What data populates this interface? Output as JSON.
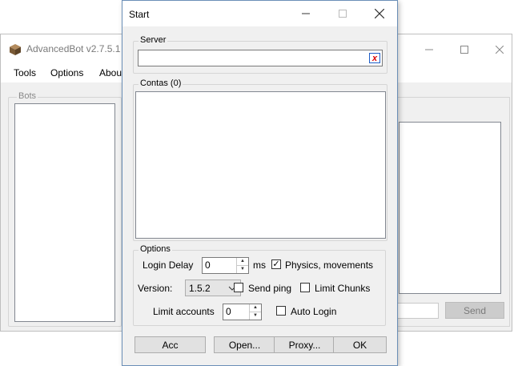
{
  "main_window": {
    "title": "AdvancedBot v2.7.5.1",
    "menu": [
      "Tools",
      "Options",
      "About"
    ],
    "bots_label": "Bots",
    "send_label": "Send"
  },
  "dialog": {
    "title": "Start",
    "server": {
      "label": "Server",
      "value": "",
      "clear_glyph": "x"
    },
    "contas": {
      "label": "Contas (0)"
    },
    "options": {
      "label": "Options",
      "login_delay": {
        "label": "Login Delay",
        "value": "0",
        "unit": "ms"
      },
      "physics": {
        "label": "Physics, movements",
        "checked": true
      },
      "version": {
        "label": "Version:",
        "value": "1.5.2"
      },
      "send_ping": {
        "label": "Send ping",
        "checked": false
      },
      "limit_chunks": {
        "label": "Limit Chunks",
        "checked": false
      },
      "limit_accounts": {
        "label": "Limit accounts",
        "value": "0"
      },
      "auto_login": {
        "label": "Auto Login",
        "checked": false
      }
    },
    "buttons": {
      "acc": "Acc",
      "open": "Open...",
      "proxy": "Proxy...",
      "ok": "OK"
    }
  },
  "icons": {
    "app": "minecraft-block-icon",
    "minimize": "minimize-icon",
    "maximize": "maximize-icon",
    "close": "close-icon",
    "check": "✓"
  },
  "colors": {
    "accent_border": "#6b8fb7",
    "clear_red": "#dd0000"
  }
}
